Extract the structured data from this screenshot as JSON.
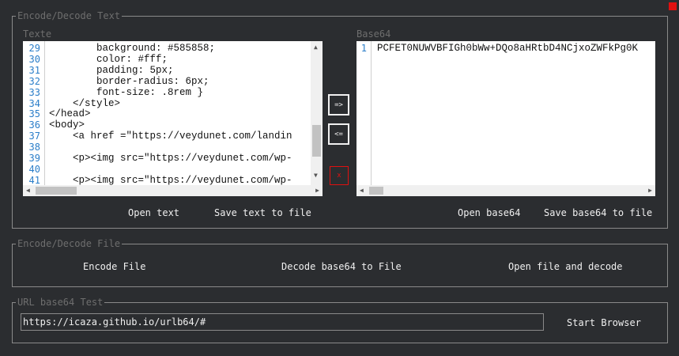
{
  "window": {
    "close_color": "#e01010"
  },
  "encode_text": {
    "legend": "Encode/Decode Text",
    "text_label": "Texte",
    "base64_label": "Base64",
    "text_lines": [
      {
        "n": "29",
        "code": "        background: #585858;"
      },
      {
        "n": "30",
        "code": "        color: #fff;"
      },
      {
        "n": "31",
        "code": "        padding: 5px;"
      },
      {
        "n": "32",
        "code": "        border-radius: 6px;"
      },
      {
        "n": "33",
        "code": "        font-size: .8rem }"
      },
      {
        "n": "34",
        "code": "    </style>"
      },
      {
        "n": "35",
        "code": "</head>"
      },
      {
        "n": "36",
        "code": "<body>"
      },
      {
        "n": "37",
        "code": "    <a href =\"https://veydunet.com/landin"
      },
      {
        "n": "38",
        "code": ""
      },
      {
        "n": "39",
        "code": "    <p><img src=\"https://veydunet.com/wp-"
      },
      {
        "n": "40",
        "code": ""
      },
      {
        "n": "41",
        "code": "    <p><img src=\"https://veydunet.com/wp-"
      }
    ],
    "base64_line_number": "1",
    "base64_text": "PCFET0NUWVBFIGh0bWw+DQo8aHRtbD4NCjxoZWFkPg0K",
    "encode_arrow": "=>",
    "decode_arrow": "<=",
    "clear": "x",
    "open_text": "Open text",
    "save_text": "Save text to file",
    "open_base64": "Open base64",
    "save_base64": "Save base64 to file"
  },
  "encode_file": {
    "legend": "Encode/Decode File",
    "encode_file": "Encode File",
    "decode_to_file": "Decode base64 to File",
    "open_and_decode": "Open file and decode"
  },
  "url_test": {
    "legend": "URL base64 Test",
    "url_value": "https://icaza.github.io/urlb64/#",
    "start_browser": "Start Browser"
  }
}
